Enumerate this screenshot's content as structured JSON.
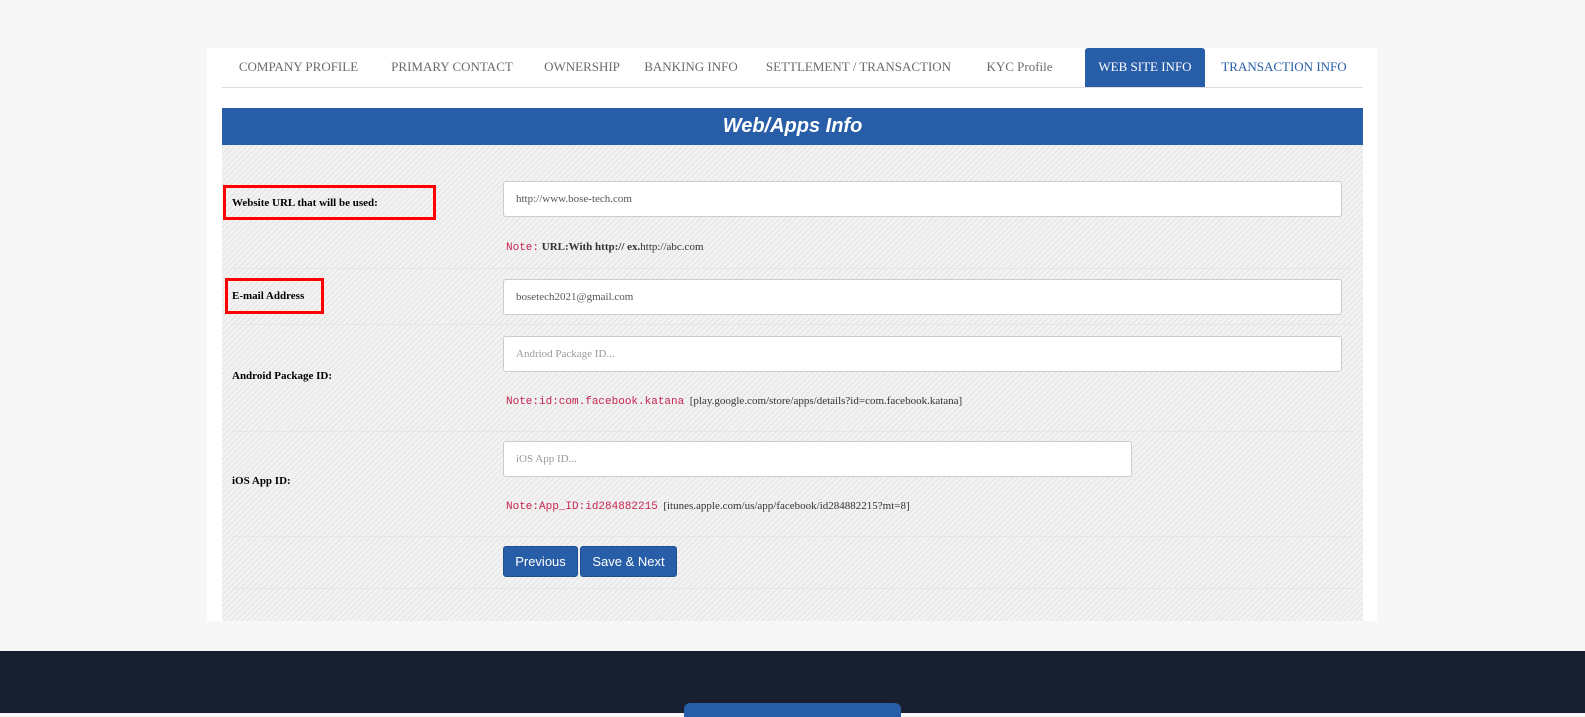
{
  "tabs": [
    {
      "label": "COMPANY PROFILE",
      "state": "default"
    },
    {
      "label": "PRIMARY CONTACT",
      "state": "default"
    },
    {
      "label": "OWNERSHIP",
      "state": "default"
    },
    {
      "label": "BANKING INFO",
      "state": "default"
    },
    {
      "label": "SETTLEMENT / TRANSACTION",
      "state": "default"
    },
    {
      "label": "KYC Profile",
      "state": "default"
    },
    {
      "label": "WEB SITE INFO",
      "state": "active"
    },
    {
      "label": "TRANSACTION INFO",
      "state": "link"
    }
  ],
  "section": {
    "title": "Web/Apps Info"
  },
  "form": {
    "website": {
      "label": "Website URL that will be used:",
      "value": "http://www.bose-tech.com",
      "note_code": "Note:",
      "note_bold": "URL:With http:// ex.",
      "note_text": "http://abc.com"
    },
    "email": {
      "label": "E-mail Address",
      "value": "bosetech2021@gmail.com"
    },
    "android": {
      "label": "Android Package ID:",
      "placeholder": "Andriod Package ID...",
      "note_code": "Note:id:com.facebook.katana",
      "note_text": "[play.google.com/store/apps/details?id=com.facebook.katana]"
    },
    "ios": {
      "label": "iOS App ID:",
      "placeholder": "iOS App ID...",
      "note_code": "Note:App_ID:id284882215",
      "note_text": "[itunes.apple.com/us/app/facebook/id284882215?mt=8]"
    }
  },
  "buttons": {
    "previous": "Previous",
    "save_next": "Save & Next"
  },
  "colors": {
    "primary": "#285ea8",
    "highlight": "#ff0000",
    "footer": "#181f2e",
    "note": "#c7254e"
  }
}
